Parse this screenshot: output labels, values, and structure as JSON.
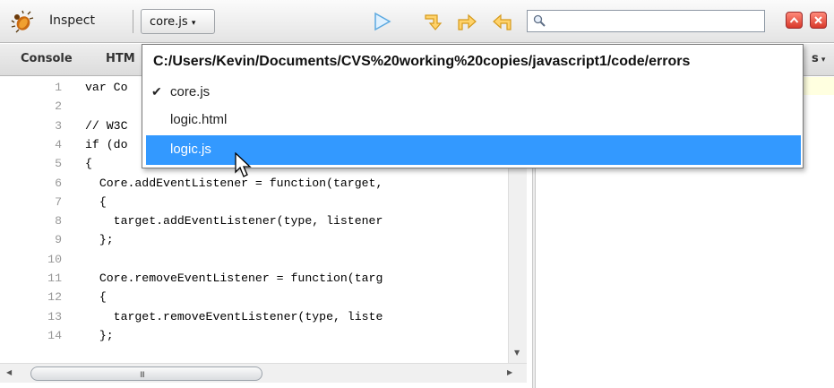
{
  "toolbar": {
    "inspect_label": "Inspect",
    "file_selector": "core.js",
    "search_value": ""
  },
  "tabs": {
    "console": "Console",
    "html": "HTM",
    "right_partial": "s"
  },
  "code": {
    "lines": [
      {
        "n": "1",
        "text": "var Co"
      },
      {
        "n": "2",
        "text": ""
      },
      {
        "n": "3",
        "text": "// W3C"
      },
      {
        "n": "4",
        "text": "if (do"
      },
      {
        "n": "5",
        "text": "{"
      },
      {
        "n": "6",
        "text": "  Core.addEventListener = function(target,"
      },
      {
        "n": "7",
        "text": "  {"
      },
      {
        "n": "8",
        "text": "    target.addEventListener(type, listener"
      },
      {
        "n": "9",
        "text": "  };"
      },
      {
        "n": "10",
        "text": ""
      },
      {
        "n": "11",
        "text": "  Core.removeEventListener = function(targ"
      },
      {
        "n": "12",
        "text": "  {"
      },
      {
        "n": "13",
        "text": "    target.removeEventListener(type, liste"
      },
      {
        "n": "14",
        "text": "  };"
      }
    ]
  },
  "dropdown": {
    "path": "C:/Users/Kevin/Documents/CVS%20working%20copies/javascript1/code/errors",
    "items": [
      {
        "label": "core.js",
        "checked": true
      },
      {
        "label": "logic.html",
        "checked": false
      },
      {
        "label": "logic.js",
        "checked": false,
        "selected": true
      }
    ]
  },
  "scrollbar_grip": "III",
  "colors": {
    "highlight": "#3399ff",
    "right_strip": "#ffffe0"
  }
}
